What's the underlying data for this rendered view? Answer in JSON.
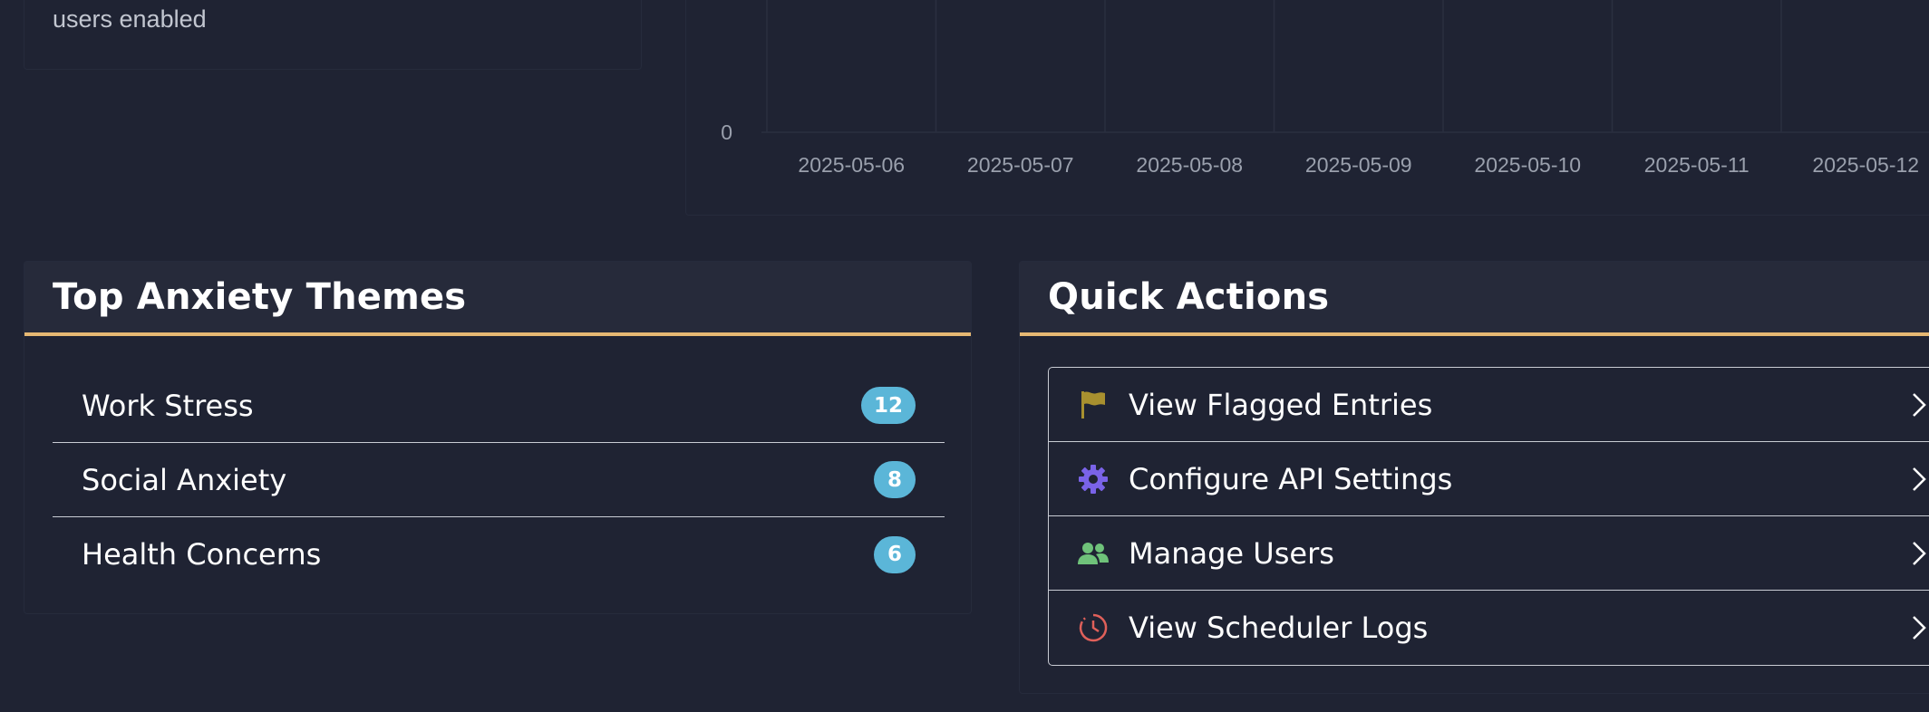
{
  "stat_card": {
    "caption": "users enabled"
  },
  "chart_data": {
    "type": "line",
    "y_ticks": [
      "0"
    ],
    "x": [
      "2025-05-06",
      "2025-05-07",
      "2025-05-08",
      "2025-05-09",
      "2025-05-10",
      "2025-05-11",
      "2025-05-12"
    ],
    "grid": true
  },
  "themes_panel": {
    "title": "Top Anxiety Themes",
    "items": [
      {
        "label": "Work Stress",
        "count": "12"
      },
      {
        "label": "Social Anxiety",
        "count": "8"
      },
      {
        "label": "Health Concerns",
        "count": "6"
      }
    ],
    "badge_color": "#5bb6d8",
    "accent_color": "#e6b873"
  },
  "actions_panel": {
    "title": "Quick Actions",
    "items": [
      {
        "label": "View Flagged Entries",
        "icon": "flag-icon",
        "color": "#a8902f"
      },
      {
        "label": "Configure API Settings",
        "icon": "gear-icon",
        "color": "#7a63e8"
      },
      {
        "label": "Manage Users",
        "icon": "users-icon",
        "color": "#6fc27a"
      },
      {
        "label": "View Scheduler Logs",
        "icon": "clock-icon",
        "color": "#e0605a"
      }
    ]
  }
}
